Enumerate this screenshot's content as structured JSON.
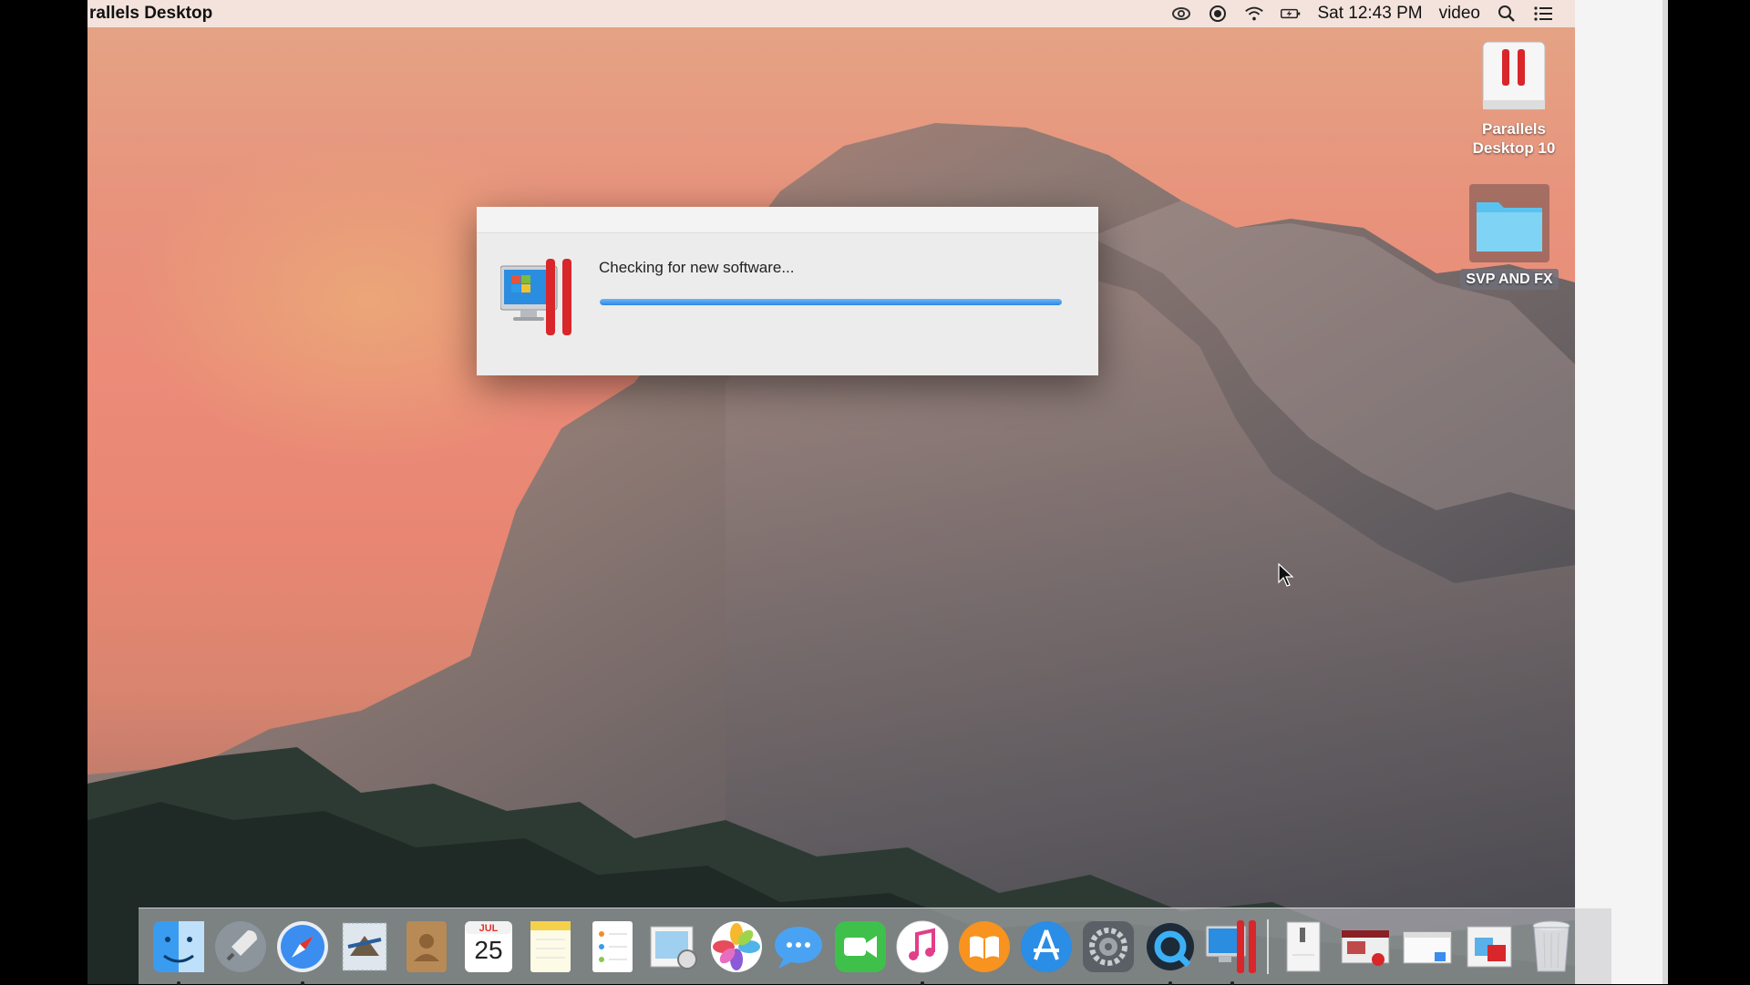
{
  "menubar": {
    "app_name": "rallels Desktop",
    "clock": "Sat 12:43 PM",
    "user": "video",
    "status_icons": [
      "creative-cloud-icon",
      "record-icon",
      "wifi-icon",
      "battery-icon",
      "spotlight-icon",
      "notification-center-icon"
    ]
  },
  "desktop": {
    "parallels_label_line1": "Parallels",
    "parallels_label_line2": "Desktop 10",
    "folder_label": "SVP AND FX"
  },
  "dialog": {
    "message": "Checking for new software...",
    "progress_percent": 100
  },
  "dock": {
    "items": [
      "Finder",
      "Launchpad",
      "Safari",
      "Mail",
      "Contacts",
      "Calendar",
      "Notes",
      "Reminders",
      "Preview",
      "Photos",
      "Messages",
      "FaceTime",
      "iTunes",
      "iBooks",
      "App Store",
      "System Preferences",
      "QuickTime Player",
      "Parallels Desktop"
    ],
    "calendar_month": "JUL",
    "calendar_day": "25"
  },
  "colors": {
    "accent_blue": "#2f86e3",
    "parallels_red": "#d8262b"
  }
}
